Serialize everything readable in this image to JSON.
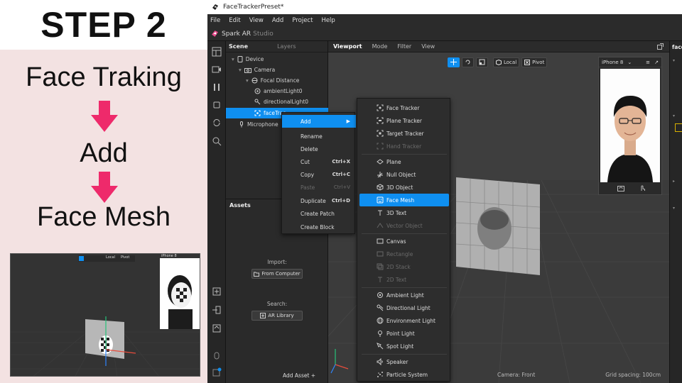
{
  "slide": {
    "title": "STEP 2",
    "steps": [
      "Face Traking",
      "Add",
      "Face Mesh"
    ],
    "accent_color": "#ee2a6b",
    "panel_bg": "#f3e2e2"
  },
  "thumbnail": {
    "tools": [
      "Local",
      "Pivot"
    ],
    "device": "iPhone 8"
  },
  "window": {
    "title": "FaceTrackerPreset*"
  },
  "menubar": [
    "File",
    "Edit",
    "View",
    "Add",
    "Project",
    "Help"
  ],
  "brand": {
    "name": "Spark AR",
    "suffix": "Studio"
  },
  "scene": {
    "tabs": [
      "Scene",
      "Layers"
    ],
    "tree": [
      {
        "label": "Device",
        "icon": "device-icon"
      },
      {
        "label": "Camera",
        "icon": "camera-icon"
      },
      {
        "label": "Focal Distance",
        "icon": "focal-distance-icon"
      },
      {
        "label": "ambientLight0",
        "icon": "ambient-light-icon"
      },
      {
        "label": "directionalLight0",
        "icon": "directional-light-icon"
      },
      {
        "label": "faceTrac",
        "icon": "face-tracker-icon"
      },
      {
        "label": "Microphone",
        "icon": "microphone-icon"
      }
    ]
  },
  "assets": {
    "title": "Assets",
    "import_label": "Import:",
    "import_button": "From Computer",
    "search_label": "Search:",
    "search_button": "AR Library",
    "add_asset": "Add Asset  +"
  },
  "viewport": {
    "tabs": [
      "Viewport",
      "Mode",
      "Filter",
      "View"
    ],
    "tools": [
      "Local",
      "Pivot"
    ],
    "device": "iPhone 8",
    "camera_label": "Camera: Front",
    "grid_label": "Grid spacing: 100cm"
  },
  "right_panel": {
    "label": "face"
  },
  "context_menu": [
    {
      "label": "Add",
      "shortcut": "",
      "state": "active",
      "submenu": true
    },
    {
      "label": "Rename",
      "shortcut": "",
      "state": "normal"
    },
    {
      "label": "Delete",
      "shortcut": "",
      "state": "normal"
    },
    {
      "label": "Cut",
      "shortcut": "Ctrl+X",
      "state": "normal"
    },
    {
      "label": "Copy",
      "shortcut": "Ctrl+C",
      "state": "normal"
    },
    {
      "label": "Paste",
      "shortcut": "Ctrl+V",
      "state": "disabled"
    },
    {
      "label": "Duplicate",
      "shortcut": "Ctrl+D",
      "state": "normal"
    },
    {
      "label": "Create Patch",
      "shortcut": "",
      "state": "normal"
    },
    {
      "label": "Create Block",
      "shortcut": "",
      "state": "normal"
    }
  ],
  "add_submenu": [
    {
      "label": "Face Tracker",
      "icon": "face-tracker-icon",
      "state": "normal"
    },
    {
      "label": "Plane Tracker",
      "icon": "plane-tracker-icon",
      "state": "normal"
    },
    {
      "label": "Target Tracker",
      "icon": "target-tracker-icon",
      "state": "normal"
    },
    {
      "label": "Hand Tracker",
      "icon": "hand-tracker-icon",
      "state": "disabled"
    },
    {
      "label": "Plane",
      "icon": "plane-icon",
      "state": "normal"
    },
    {
      "label": "Null Object",
      "icon": "null-object-icon",
      "state": "normal"
    },
    {
      "label": "3D Object",
      "icon": "3d-object-icon",
      "state": "normal"
    },
    {
      "label": "Face Mesh",
      "icon": "face-mesh-icon",
      "state": "active"
    },
    {
      "label": "3D Text",
      "icon": "3d-text-icon",
      "state": "normal"
    },
    {
      "label": "Vector Object",
      "icon": "vector-object-icon",
      "state": "disabled"
    },
    {
      "label": "Canvas",
      "icon": "canvas-icon",
      "state": "normal"
    },
    {
      "label": "Rectangle",
      "icon": "rectangle-icon",
      "state": "disabled"
    },
    {
      "label": "2D Stack",
      "icon": "2d-stack-icon",
      "state": "disabled"
    },
    {
      "label": "2D Text",
      "icon": "2d-text-icon",
      "state": "disabled"
    },
    {
      "label": "Ambient Light",
      "icon": "ambient-light-icon",
      "state": "normal"
    },
    {
      "label": "Directional Light",
      "icon": "directional-light-icon",
      "state": "normal"
    },
    {
      "label": "Environment Light",
      "icon": "environment-light-icon",
      "state": "normal"
    },
    {
      "label": "Point Light",
      "icon": "point-light-icon",
      "state": "normal"
    },
    {
      "label": "Spot Light",
      "icon": "spot-light-icon",
      "state": "normal"
    },
    {
      "label": "Speaker",
      "icon": "speaker-icon",
      "state": "normal"
    },
    {
      "label": "Particle System",
      "icon": "particle-system-icon",
      "state": "normal"
    }
  ]
}
